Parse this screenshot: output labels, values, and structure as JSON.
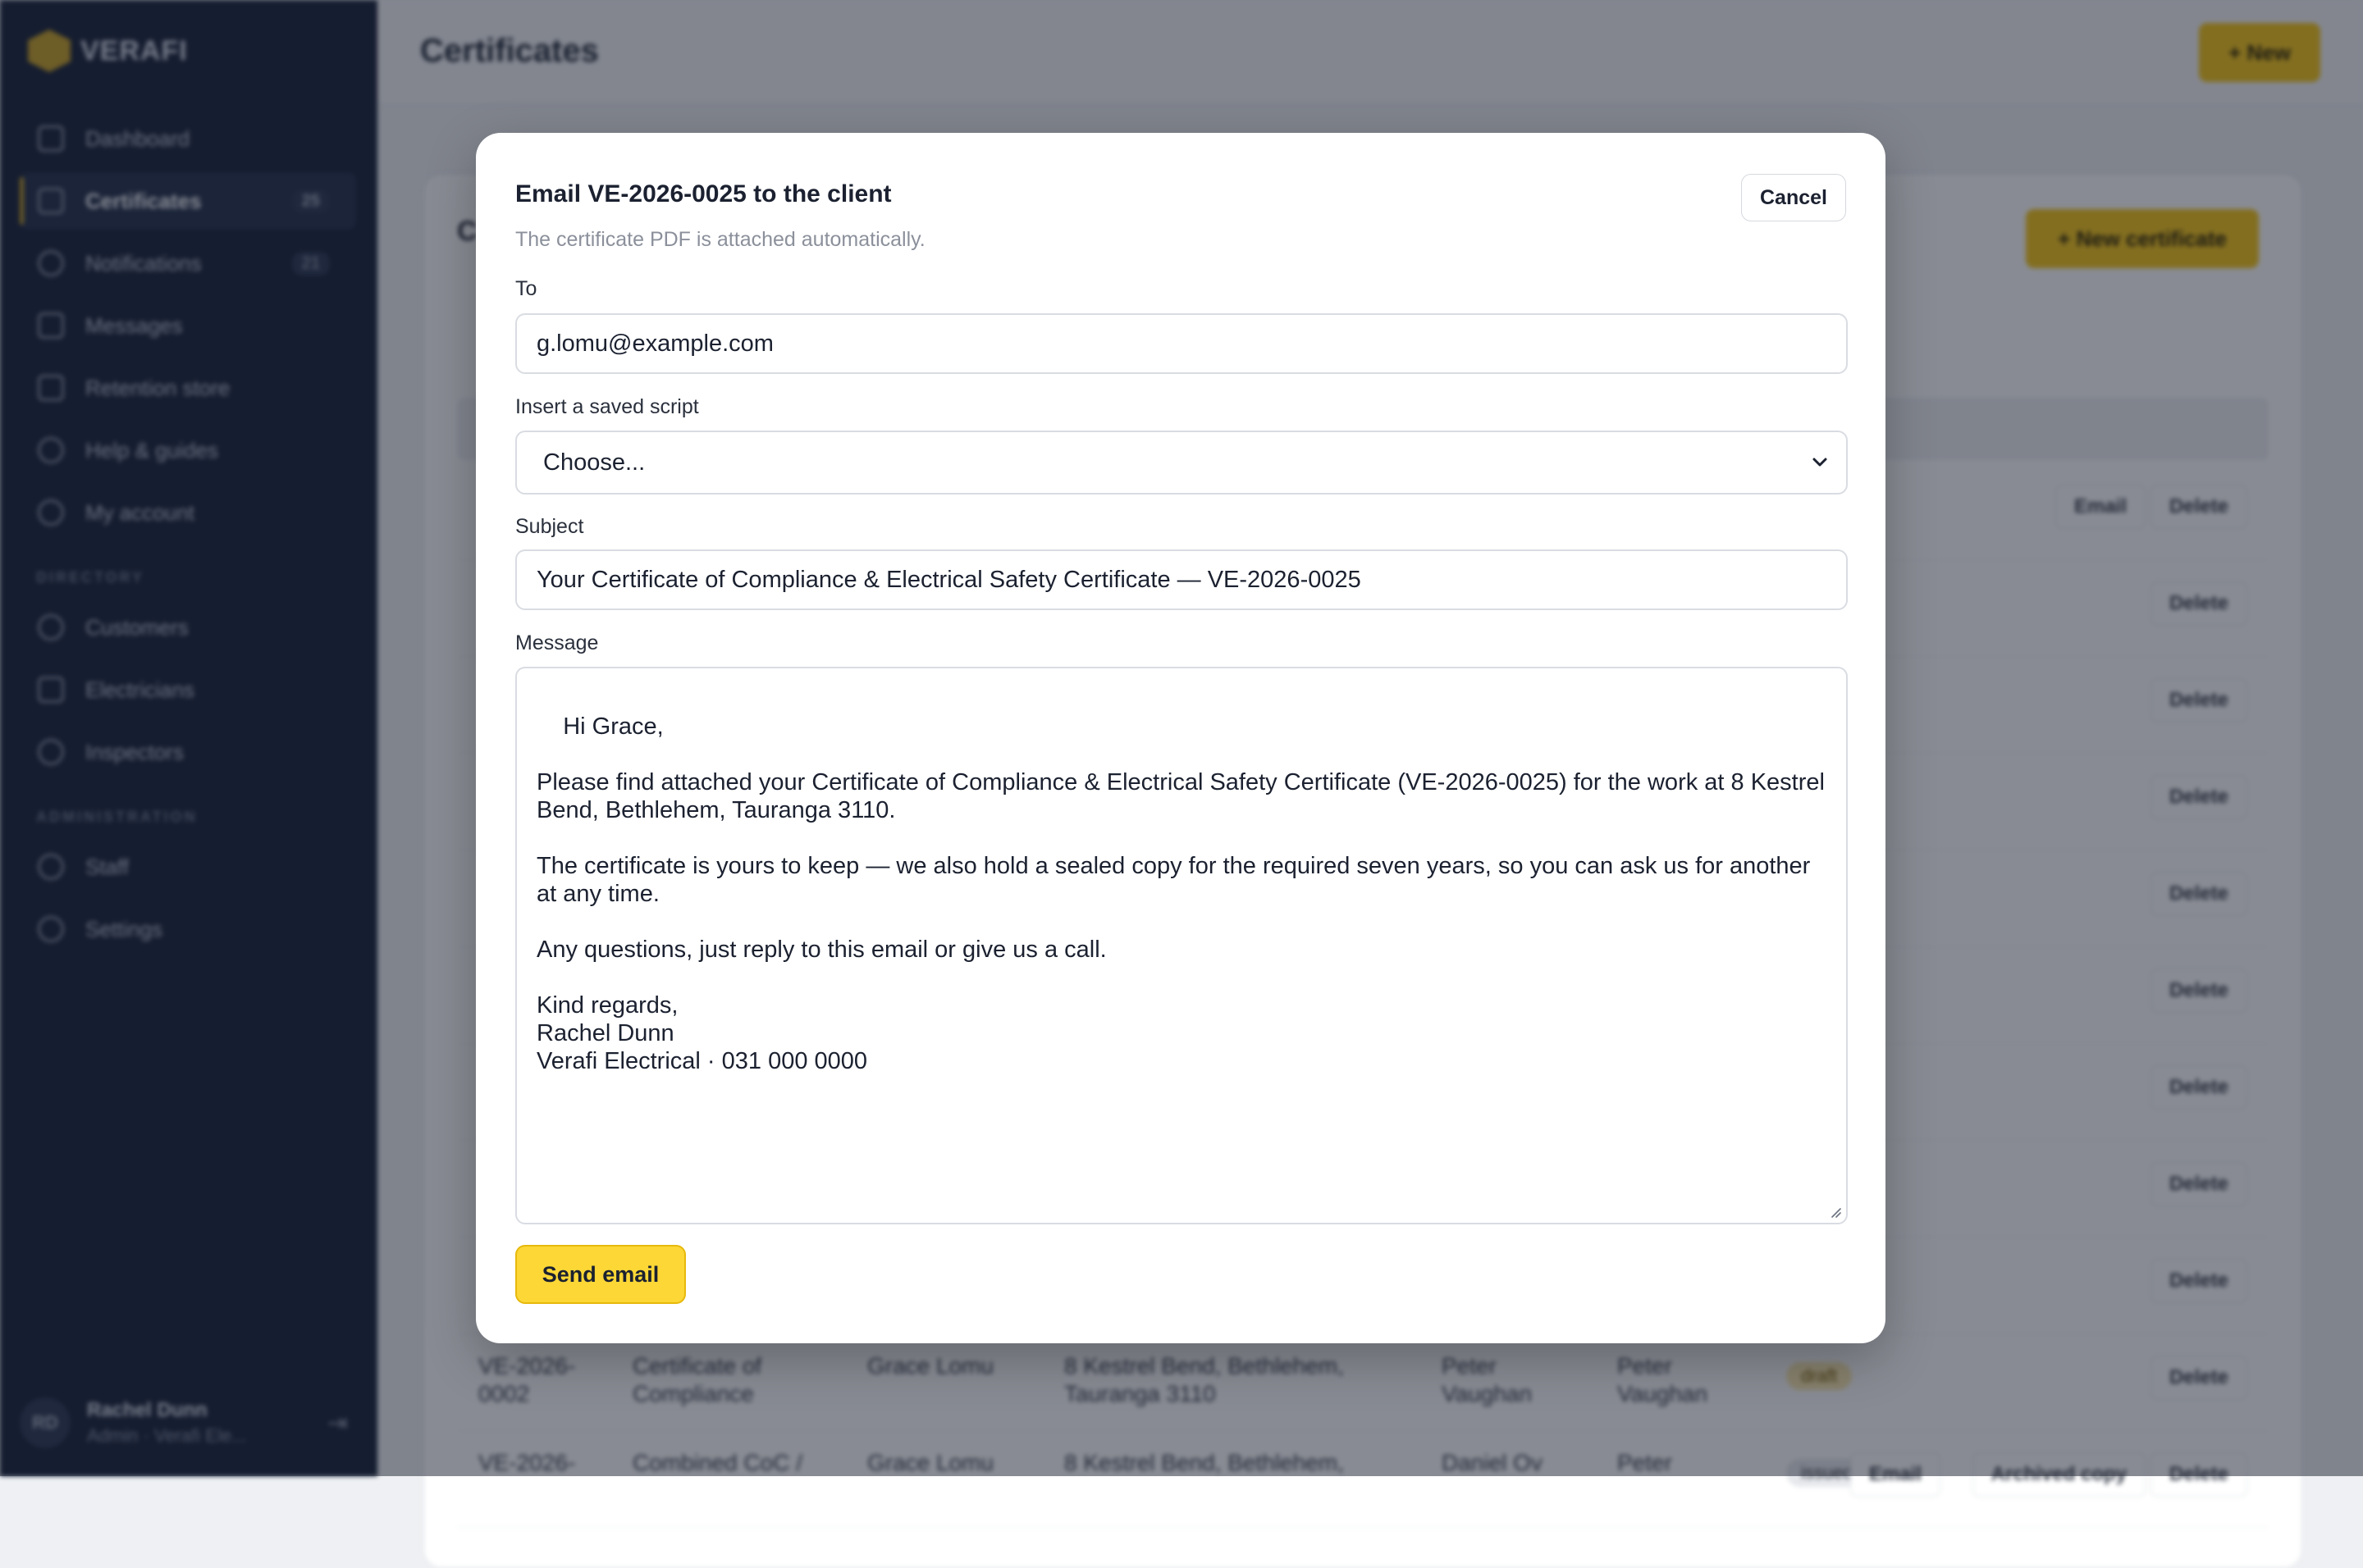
{
  "sidebar": {
    "brand": "VERAFI",
    "nav": [
      {
        "label": "Dashboard",
        "icon": "dashboard-icon"
      },
      {
        "label": "Certificates",
        "icon": "document-icon",
        "count": "25",
        "active": true
      },
      {
        "label": "Notifications",
        "icon": "bell-icon",
        "count": "21"
      },
      {
        "label": "Messages",
        "icon": "mail-icon"
      },
      {
        "label": "Retention store",
        "icon": "box-icon"
      },
      {
        "label": "Help & guides",
        "icon": "help-icon"
      },
      {
        "label": "My account",
        "icon": "user-icon"
      }
    ],
    "section_directory": "DIRECTORY",
    "directory": [
      {
        "label": "Customers",
        "icon": "users-icon"
      },
      {
        "label": "Electricians",
        "icon": "electrician-icon"
      },
      {
        "label": "Inspectors",
        "icon": "shield-icon"
      }
    ],
    "section_admin": "ADMINISTRATION",
    "admin": [
      {
        "label": "Staff",
        "icon": "staff-icon"
      },
      {
        "label": "Settings",
        "icon": "gear-icon"
      }
    ],
    "user": {
      "initials": "RD",
      "name": "Rachel Dunn",
      "role": "Admin · Verafi Ele..."
    }
  },
  "header": {
    "title": "Certificates",
    "new_button": "+ New"
  },
  "card": {
    "title_fragment": "C",
    "new_certificate_button": "+ New certificate",
    "row_actions": {
      "email": "Email",
      "delete": "Delete"
    },
    "rows": [
      {
        "id": "VE-2026-0002",
        "type": "Certificate of Compliance",
        "customer": "Grace Lomu",
        "address": "8 Kestrel Bend, Bethlehem, Tauranga 3110",
        "electrician": "Peter Vaughan",
        "inspector": "Peter Vaughan",
        "status": "draft"
      },
      {
        "id": "VE-2026-",
        "type": "Combined CoC /",
        "customer": "Grace Lomu",
        "address": "8 Kestrel Bend, Bethlehem,",
        "electrician": "Daniel Ov",
        "inspector": "Peter",
        "status": "issued",
        "archived": "Archived copy"
      }
    ]
  },
  "modal": {
    "title": "Email VE-2026-0025 to the client",
    "subtitle": "The certificate PDF is attached automatically.",
    "cancel": "Cancel",
    "to_label": "To",
    "to_value": "g.lomu@example.com",
    "script_label": "Insert a saved script",
    "script_value": "Choose...",
    "subject_label": "Subject",
    "subject_value": "Your Certificate of Compliance & Electrical Safety Certificate — VE-2026-0025",
    "message_label": "Message",
    "message_value": "Hi Grace,\n\nPlease find attached your Certificate of Compliance & Electrical Safety Certificate (VE-2026-0025) for the work at 8 Kestrel Bend, Bethlehem, Tauranga 3110.\n\nThe certificate is yours to keep — we also hold a sealed copy for the required seven years, so you can ask us for another at any time.\n\nAny questions, just reply to this email or give us a call.\n\nKind regards,\nRachel Dunn\nVerafi Electrical · 031 000 0000",
    "send": "Send email"
  }
}
